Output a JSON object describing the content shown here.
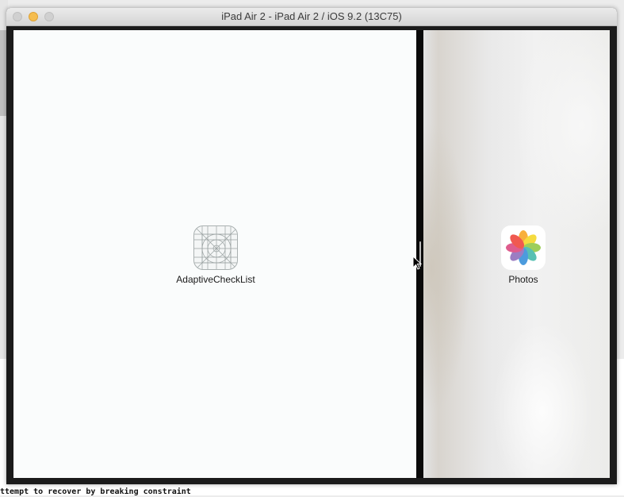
{
  "window": {
    "title": "iPad Air 2 - iPad Air 2 / iOS 9.2 (13C75)"
  },
  "springboard": {
    "left_app": {
      "label": "AdaptiveCheckList",
      "icon": "app-placeholder-icon"
    },
    "right_app": {
      "label": "Photos",
      "icon": "photos-icon"
    }
  },
  "console": {
    "bottom_line": "ttempt to recover by breaking constraint"
  },
  "colors": {
    "minimize_button": "#f5bd4f",
    "bezel": "#1b1b1b",
    "screen_background": "#fafcfc"
  }
}
